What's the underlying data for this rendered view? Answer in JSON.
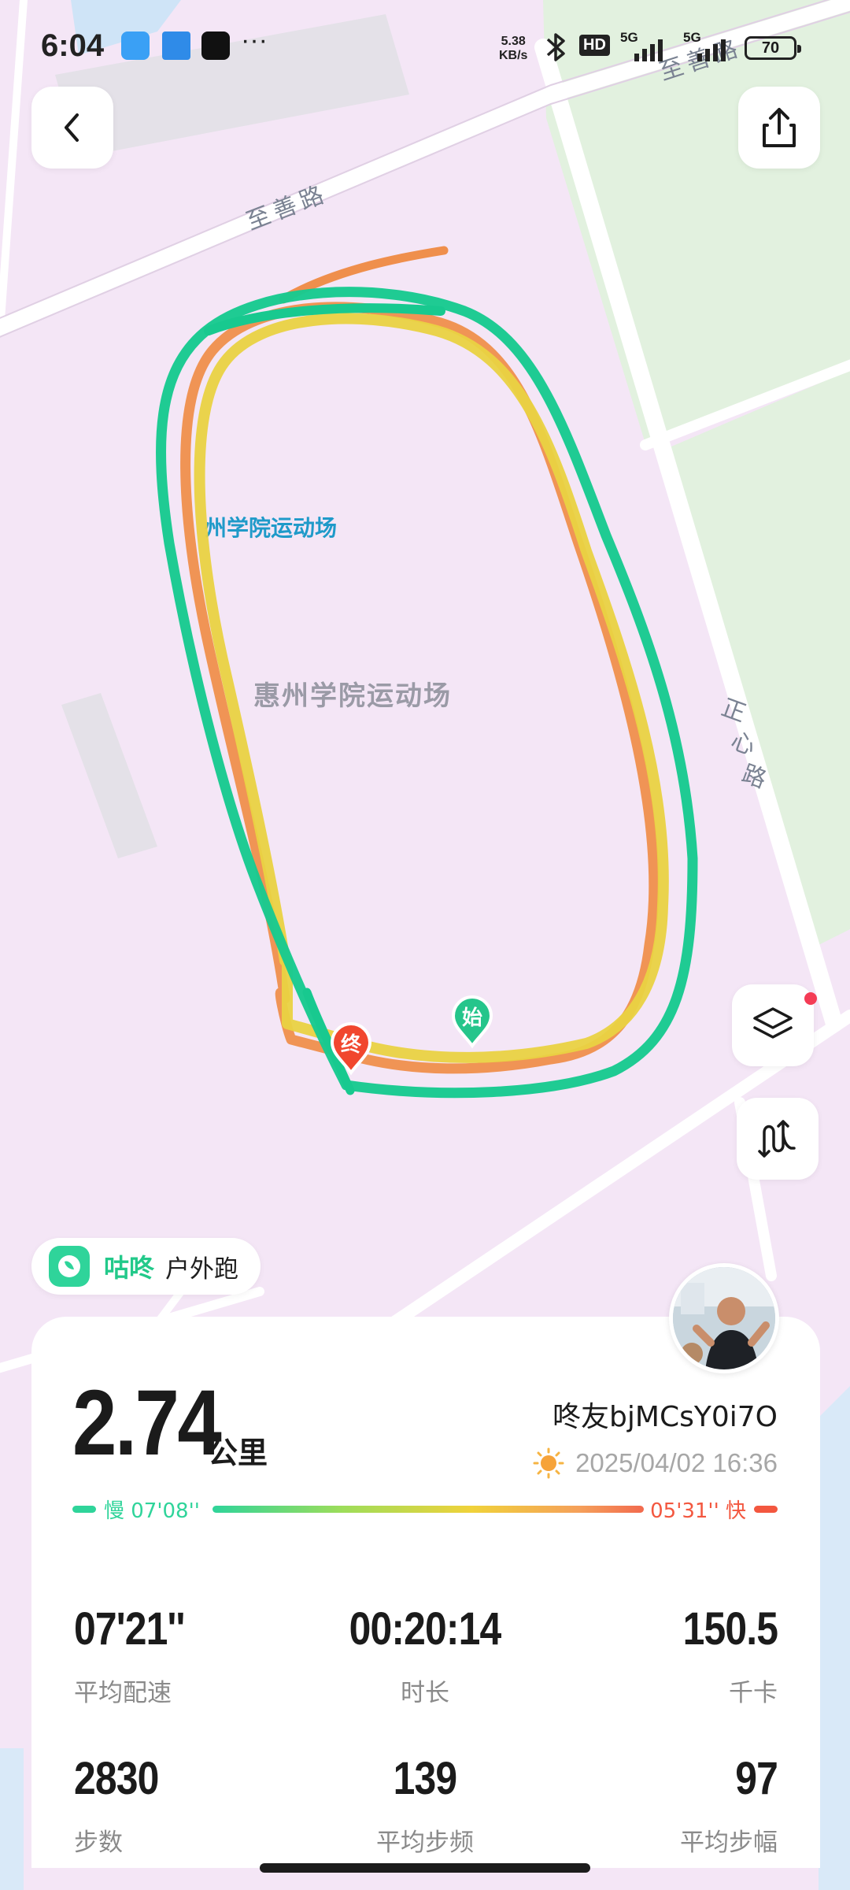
{
  "status_bar": {
    "time": "6:04",
    "more": "···",
    "net_speed_value": "5.38",
    "net_speed_unit": "KB/s",
    "hd_label": "HD",
    "sim1_label": "5G",
    "sim2_label": "5G",
    "battery_level": "70"
  },
  "map": {
    "road_top": "至善路",
    "road_top_right": "至善路",
    "road_right": "正心路",
    "poi_label_blue": "州学院运动场",
    "poi_label_gray": "惠州学院运动场",
    "start_marker": "始",
    "end_marker": "终",
    "route_colors": [
      "#18c98f",
      "#e9d242",
      "#ef8f4c"
    ]
  },
  "brand": {
    "name": "咕咚",
    "mode": "户外跑"
  },
  "summary": {
    "distance": "2.74",
    "distance_unit": "公里",
    "user_name": "咚友bjMCsY0i7O",
    "datetime": "2025/04/02 16:36",
    "weather_icon": "sun-icon",
    "pace_slow_label": "慢 07'08''",
    "pace_fast_label": "05'31'' 快"
  },
  "stats": [
    {
      "value": "07'21''",
      "label": "平均配速"
    },
    {
      "value": "00:20:14",
      "label": "时长"
    },
    {
      "value": "150.5",
      "label": "千卡"
    },
    {
      "value": "2830",
      "label": "步数"
    },
    {
      "value": "139",
      "label": "平均步频"
    },
    {
      "value": "97",
      "label": "平均步幅"
    }
  ]
}
